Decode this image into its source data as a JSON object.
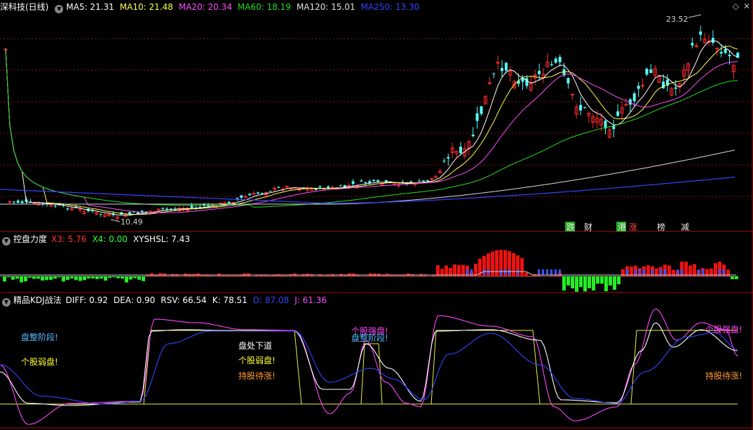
{
  "colors": {
    "up": "#ff2c2c",
    "down": "#54ffff",
    "ma5": "#ffffff",
    "ma10": "#ffff55",
    "ma20": "#ff4bff",
    "ma60": "#22dd22",
    "ma120": "#d8d8d8",
    "ma250": "#3344ff",
    "grid": "#8a1010",
    "panel_border": "#a01010"
  },
  "main": {
    "title": "深科技(日线)",
    "ma": [
      {
        "label": "MA5: 21.31",
        "color": "#ffffff"
      },
      {
        "label": "MA10: 21.48",
        "color": "#ffff55"
      },
      {
        "label": "MA20: 20.34",
        "color": "#ff4bff"
      },
      {
        "label": "MA60: 18.19",
        "color": "#22dd22"
      },
      {
        "label": "MA120: 15.01",
        "color": "#e0e0e0"
      },
      {
        "label": "MA250: 13.30",
        "color": "#3344ff"
      }
    ],
    "high_label": "23.52",
    "low_label": "10.49",
    "markers": [
      {
        "text": "跌",
        "color": "#e8e8e8"
      },
      {
        "text": "财",
        "color": "#e8e8e8"
      },
      {
        "text": "港",
        "color": "#e8e8e8"
      },
      {
        "text": "涨",
        "color": "#ff4444"
      },
      {
        "text": "榜",
        "color": "#e8e8e8"
      },
      {
        "text": "减",
        "color": "#e8e8e8"
      }
    ],
    "corner_icons": [
      "diamond-icon",
      "close-icon"
    ]
  },
  "panel2": {
    "title": "控盘力度",
    "values": [
      {
        "label": "X3: 5.76",
        "color": "#ff3333"
      },
      {
        "label": "X4: 0.00",
        "color": "#33ff33"
      },
      {
        "label": "XYSHSL: 7.43",
        "color": "#ffffff"
      }
    ]
  },
  "panel3": {
    "title": "精品KDJ战法",
    "values": [
      {
        "label": "DIFF: 0.92",
        "color": "#ffffff"
      },
      {
        "label": "DEA: 0.90",
        "color": "#ffffff"
      },
      {
        "label": "RSV: 66.54",
        "color": "#ffffff"
      },
      {
        "label": "K: 78.51",
        "color": "#ffffff"
      },
      {
        "label": "D: 87.08",
        "color": "#3344ff"
      },
      {
        "label": "J: 61.36",
        "color": "#ff4bff"
      }
    ],
    "signals": [
      {
        "text": "盘整阶段!",
        "color": "#55bbff"
      },
      {
        "text": "个股弱盘!",
        "color": "#ffff33"
      },
      {
        "text": "盘处下道",
        "color": "#ffffff"
      },
      {
        "text": "个股弱盘!",
        "color": "#ffff33"
      },
      {
        "text": "持股待涨!",
        "color": "#ff9933"
      },
      {
        "text": "个股强盘!",
        "color": "#ff44ff"
      },
      {
        "text": "盘整阶段!",
        "color": "#55bbff"
      },
      {
        "text": "个股强盘!",
        "color": "#ff44ff"
      },
      {
        "text": "持股待涨!",
        "color": "#ff9933"
      }
    ]
  }
}
